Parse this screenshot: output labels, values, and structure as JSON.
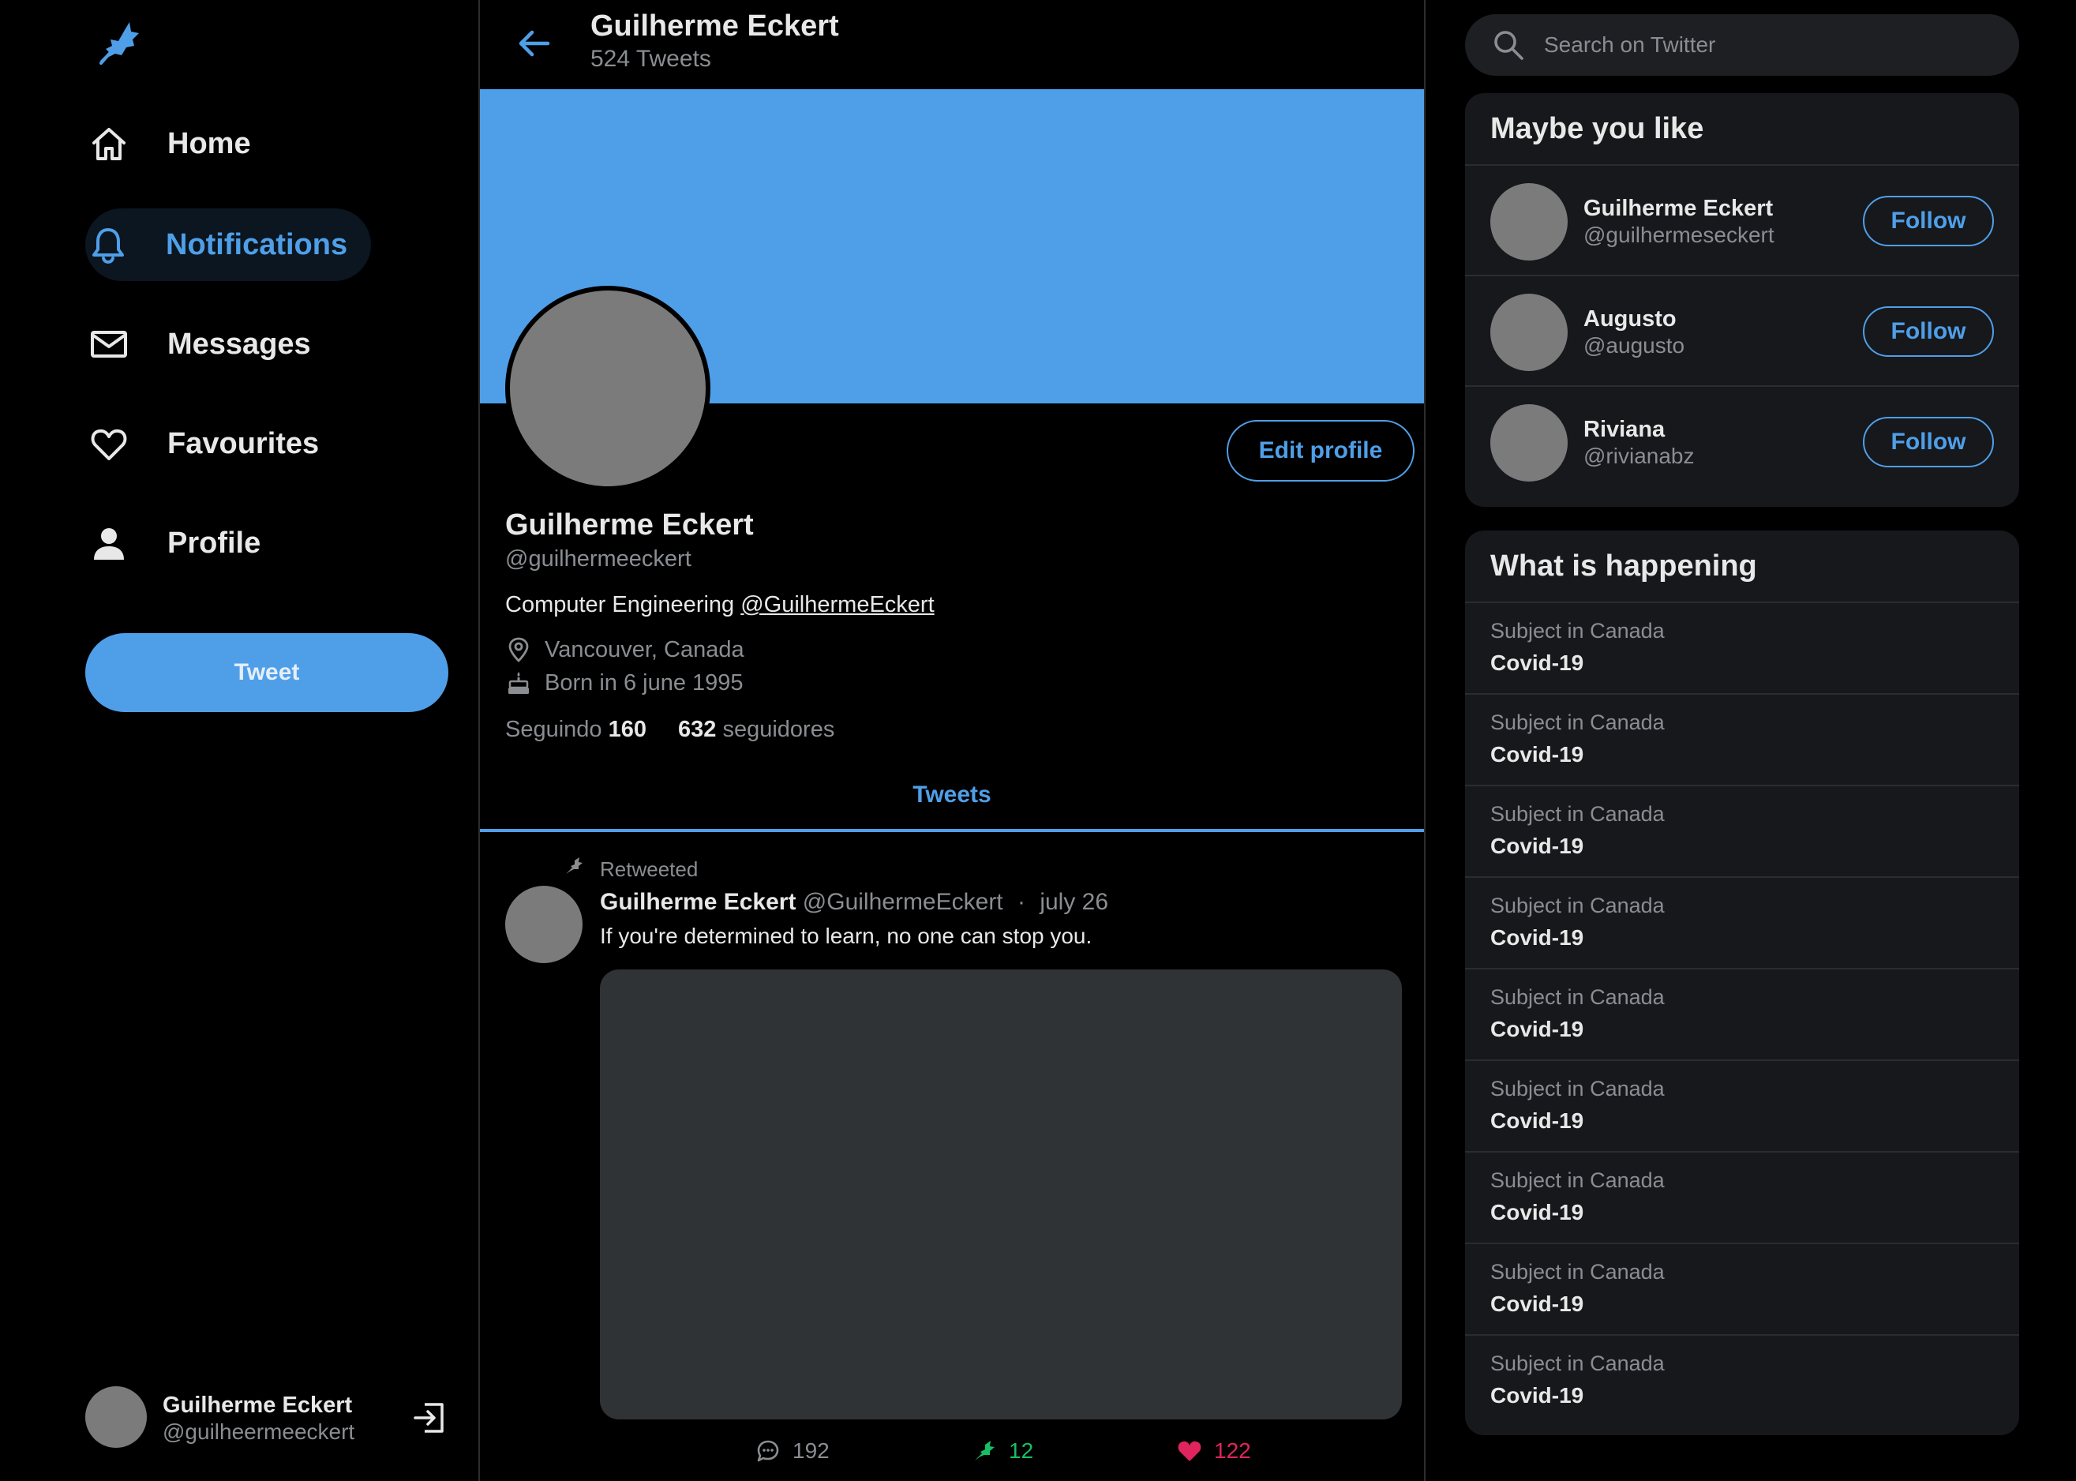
{
  "sidebar": {
    "logo_icon": "bird-icon",
    "nav": [
      {
        "label": "Home",
        "icon": "home-icon",
        "active": false
      },
      {
        "label": "Notifications",
        "icon": "bell-icon",
        "active": true
      },
      {
        "label": "Messages",
        "icon": "envelope-icon",
        "active": false
      },
      {
        "label": "Favourites",
        "icon": "heart-icon",
        "active": false
      },
      {
        "label": "Profile",
        "icon": "user-icon",
        "active": false
      }
    ],
    "tweet_button": "Tweet",
    "account": {
      "name": "Guilherme Eckert",
      "handle": "@guilheermeeckert",
      "logout_icon": "logout-icon"
    }
  },
  "header": {
    "name": "Guilherme Eckert",
    "tweet_count": "524 Tweets"
  },
  "profile": {
    "banner_color": "#4f9fe8",
    "edit_button": "Edit profile",
    "name": "Guilherme Eckert",
    "handle": "@guilhermeeckert",
    "bio_text": "Computer Engineering ",
    "bio_mention": "@GuilhermeEckert",
    "location": "Vancouver, Canada",
    "birthday": "Born in 6 june 1995",
    "following_label": "Seguindo",
    "following_count": "160",
    "followers_count": "632",
    "followers_label": "seguidores"
  },
  "tabs": {
    "tweets": "Tweets"
  },
  "tweet": {
    "retweet_label": "Retweeted",
    "author_name": "Guilherme Eckert",
    "author_handle": "@GuilhermeEckert",
    "separator": "·",
    "date": "july 26",
    "text": "If you're determined to learn, no one can stop you.",
    "replies": "192",
    "retweets": "12",
    "likes": "122"
  },
  "search": {
    "placeholder": "Search on Twitter"
  },
  "suggestions": {
    "title": "Maybe you like",
    "follow_label": "Follow",
    "people": [
      {
        "name": "Guilherme Eckert",
        "handle": "@guilhermeseckert"
      },
      {
        "name": "Augusto",
        "handle": "@augusto"
      },
      {
        "name": "Riviana",
        "handle": "@rivianabz"
      }
    ]
  },
  "trends": {
    "title": "What is happening",
    "items": [
      {
        "category": "Subject in Canada",
        "topic": "Covid-19"
      },
      {
        "category": "Subject in Canada",
        "topic": "Covid-19"
      },
      {
        "category": "Subject in Canada",
        "topic": "Covid-19"
      },
      {
        "category": "Subject in Canada",
        "topic": "Covid-19"
      },
      {
        "category": "Subject in Canada",
        "topic": "Covid-19"
      },
      {
        "category": "Subject in Canada",
        "topic": "Covid-19"
      },
      {
        "category": "Subject in Canada",
        "topic": "Covid-19"
      },
      {
        "category": "Subject in Canada",
        "topic": "Covid-19"
      },
      {
        "category": "Subject in Canada",
        "topic": "Covid-19"
      }
    ]
  },
  "colors": {
    "accent": "#4f9fe8",
    "retweet": "#17bf63",
    "like": "#e0245e"
  }
}
